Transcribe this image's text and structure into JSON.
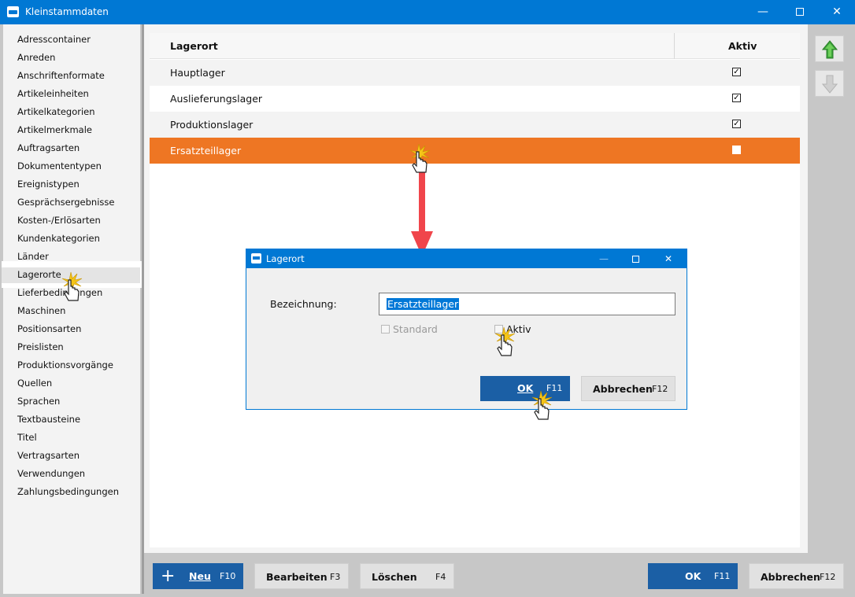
{
  "window": {
    "title": "Kleinstammdaten",
    "min_glyph": "—",
    "close_glyph": "✕"
  },
  "sidebar": {
    "items": [
      "Adresscontainer",
      "Anreden",
      "Anschriftenformate",
      "Artikeleinheiten",
      "Artikelkategorien",
      "Artikelmerkmale",
      "Auftragsarten",
      "Dokumententypen",
      "Ereignistypen",
      "Gesprächsergebnisse",
      "Kosten-/Erlösarten",
      "Kundenkategorien",
      "Länder",
      "Lagerorte",
      "Lieferbedingungen",
      "Maschinen",
      "Positionsarten",
      "Preislisten",
      "Produktionsvorgänge",
      "Quellen",
      "Sprachen",
      "Textbausteine",
      "Titel",
      "Vertragsarten",
      "Verwendungen",
      "Zahlungsbedingungen"
    ],
    "selected_index": 13
  },
  "grid": {
    "columns": {
      "name": "Lagerort",
      "active": "Aktiv"
    },
    "rows": [
      {
        "name": "Hauptlager",
        "active": true,
        "check": "✓"
      },
      {
        "name": "Auslieferungslager",
        "active": true,
        "check": "✓"
      },
      {
        "name": "Produktionslager",
        "active": true,
        "check": "✓"
      },
      {
        "name": "Ersatzteillager",
        "active": false,
        "check": ""
      }
    ],
    "selected_row": 3
  },
  "toolbar": {
    "new": {
      "icon": "+",
      "label": "Neu",
      "key": "F10"
    },
    "edit": {
      "label": "Bearbeiten",
      "key": "F3"
    },
    "delete": {
      "label": "Löschen",
      "key": "F4"
    },
    "ok": {
      "label": "OK",
      "key": "F11"
    },
    "cancel": {
      "label": "Abbrechen",
      "key": "F12"
    }
  },
  "dialog": {
    "title": "Lagerort",
    "min_glyph": "—",
    "close_glyph": "✕",
    "field_label": "Bezeichnung:",
    "field_value": "Ersatzteillager",
    "standard_label": "Standard",
    "standard_checked": false,
    "active_label": "Aktiv",
    "active_checked": false,
    "ok_label": "OK",
    "ok_key": "F11",
    "cancel_label": "Abbrechen",
    "cancel_key": "F12"
  },
  "colors": {
    "accent": "#0078d4",
    "selection": "#ee7623",
    "primary_button": "#1b5fa5",
    "annotation_arrow": "#f0454b"
  }
}
